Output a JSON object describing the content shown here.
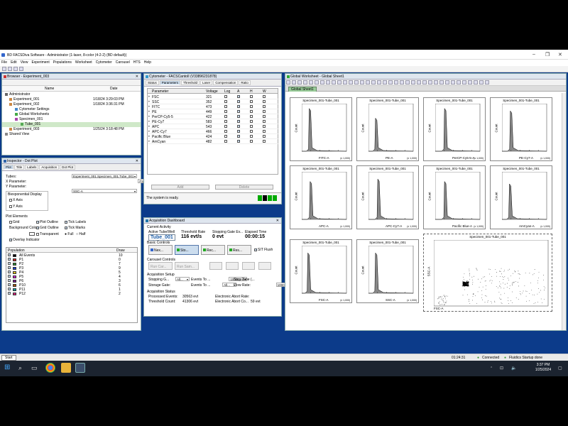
{
  "app": {
    "title": "BD FACSDiva Software - Administrator (1-laser, 8-color (4-2-2) (BD default))"
  },
  "menu": [
    "File",
    "Edit",
    "View",
    "Experiment",
    "Populations",
    "Worksheet",
    "Cytometer",
    "Carousel",
    "HTS",
    "Help"
  ],
  "browser": {
    "title": "Browser - Experiment_003",
    "col_name": "Name",
    "col_date": "Date",
    "items": [
      {
        "name": "Administrator",
        "date": ""
      },
      {
        "name": "Experiment_001",
        "date": "1/18/24 3:29:03 PM"
      },
      {
        "name": "Experiment_002",
        "date": "1/18/24 3:36:31 PM"
      },
      {
        "name": "Cytometer Settings",
        "date": ""
      },
      {
        "name": "Global Worksheets",
        "date": ""
      },
      {
        "name": "Specimen_001",
        "date": ""
      },
      {
        "name": "Tube_001",
        "date": ""
      },
      {
        "name": "Experiment_003",
        "date": "1/25/24 3:18:48 PM"
      },
      {
        "name": "Shared View",
        "date": ""
      }
    ]
  },
  "inspector": {
    "title": "Inspector - Dot Plot",
    "tabs": [
      "Plot",
      "Title",
      "Labels",
      "Acquisition",
      "Dot Plot"
    ],
    "tubes_label": "Tubes:",
    "tubes_value": "Experiment_001.Specimen_001.Tube_001",
    "xparam_label": "X Parameter:",
    "xparam_value": "FSC-A",
    "yparam_label": "Y Parameter:",
    "yparam_value": "SSC-A",
    "bi_label": "Biexponential Display",
    "xaxis": "X Axis",
    "yaxis": "Y Axis",
    "plot_elements": "Plot Elements",
    "grid": "Grid",
    "plot_outline": "Plot Outline",
    "tick_labels": "Tick Labels",
    "gridlines": "Grid Outline",
    "tick_marks": "Tick Marks",
    "bg_color": "Background Color:",
    "transparent": "Transparent",
    "full": "Full",
    "half": "Half",
    "overlay": "Overlay Indicator",
    "pop_header": "Population",
    "draw_header": "Draw",
    "populations": [
      {
        "name": "All Events",
        "draw": "10",
        "color": "#000000"
      },
      {
        "name": "P1",
        "draw": "0",
        "color": "#d62020"
      },
      {
        "name": "P2",
        "draw": "7",
        "color": "#2a8a2a"
      },
      {
        "name": "P3",
        "draw": "9",
        "color": "#1a3fd0"
      },
      {
        "name": "P4",
        "draw": "5",
        "color": "#e0c020"
      },
      {
        "name": "P5",
        "draw": "4",
        "color": "#d020d0"
      },
      {
        "name": "P6",
        "draw": "3",
        "color": "#7a1a8a"
      },
      {
        "name": "P10",
        "draw": "6",
        "color": "#aa5500"
      },
      {
        "name": "P11",
        "draw": "1",
        "color": "#00a0a0"
      },
      {
        "name": "P12",
        "draw": "2",
        "color": "#e02080"
      }
    ]
  },
  "cytometer": {
    "title": "Cytometer - FACSCantoII (V33896231878)",
    "tabs": [
      "Status",
      "Parameters",
      "Threshold",
      "Laser",
      "Compensation",
      "Ratio"
    ],
    "headers": [
      "Parameter",
      "Voltage",
      "Log",
      "A",
      "H",
      "W"
    ],
    "params": [
      {
        "name": "FSC",
        "voltage": "321"
      },
      {
        "name": "SSC",
        "voltage": "352"
      },
      {
        "name": "FITC",
        "voltage": "473"
      },
      {
        "name": "PE",
        "voltage": "449"
      },
      {
        "name": "PerCP-Cy5-5",
        "voltage": "422"
      },
      {
        "name": "PE-Cy7",
        "voltage": "583"
      },
      {
        "name": "APC",
        "voltage": "543"
      },
      {
        "name": "APC-Cy7",
        "voltage": "466"
      },
      {
        "name": "Pacific Blue",
        "voltage": "424"
      },
      {
        "name": "AmCyan",
        "voltage": "482"
      }
    ],
    "add": "Add",
    "delete": "Delete",
    "status": "The system is ready."
  },
  "acq": {
    "title": "Acquisition Dashboard",
    "current_activity": "Current Activity",
    "active_tube_label": "Active Tube/Well",
    "threshold_rate_label": "Threshold Rate",
    "stopping_gate_label": "Stopping Gate Ev...",
    "elapsed_label": "Elapsed Time",
    "active_tube": "Tube_001",
    "threshold_rate": "116 evt/s",
    "stopping_gate": "0 evt",
    "elapsed": "00:00:15",
    "basic_controls": "Basic Controls",
    "next": "Nex...",
    "stop": "Sto...",
    "record": "Rec...",
    "restart": "Res...",
    "sit_flush": "SIT Flush",
    "carousel_controls": "Carousel Controls",
    "run_car": "Run Car...",
    "run_sam": "Run Sam...",
    "acq_setup": "Acquisition Setup",
    "stopping_gate_field": "Stopping G...",
    "stopping_gate_value": "All...",
    "events_to_record_label": "Events To ...",
    "events_to_record": "10000 evt",
    "stop_time_label": "Stop Time (...",
    "stop_time": "0",
    "storage_gate_label": "Storage Gate:",
    "storage_gate_value": "All...",
    "events_to_display_label": "Events To ...",
    "events_to_display": "1000 evt",
    "flow_rate_label": "Flow Rate:",
    "flow_rate": "Low",
    "acq_status": "Acquisition Status",
    "processed_label": "Processed Events:",
    "processed": "30563 evt",
    "threshold_count_label": "Threshold Count:",
    "threshold_count": "41306 evt",
    "elec_abort_rate_label": "Electronic Abort Rate:",
    "elec_abort_rate": "",
    "elec_abort_count_label": "Electronic Abort Co...",
    "elec_abort_count": "59 evt"
  },
  "worksheet": {
    "title": "Global Worksheet - Global Sheet1",
    "tab": "Global Sheet1",
    "plot_title": "Specimen_001-Tube_001",
    "count_label": "Count",
    "histograms": [
      {
        "x_label": "FITC-A",
        "peak": 0.18,
        "height": 0.9
      },
      {
        "x_label": "PE-A",
        "peak": 0.17,
        "height": 0.7
      },
      {
        "x_label": "PerCP-Cy5-5-A",
        "peak": 0.22,
        "height": 0.9
      },
      {
        "x_label": "PE-Cy7-A",
        "peak": 0.2,
        "height": 0.85
      },
      {
        "x_label": "APC-A",
        "peak": 0.2,
        "height": 0.8
      },
      {
        "x_label": "APC-Cy7-A",
        "peak": 0.22,
        "height": 0.85
      },
      {
        "x_label": "Pacific Blue-A",
        "peak": 0.22,
        "height": 0.8
      },
      {
        "x_label": "AmCyan-A",
        "peak": 0.18,
        "height": 0.75
      },
      {
        "x_label": "FSC-A",
        "peak": 0.15,
        "height": 0.85
      },
      {
        "x_label": "SSC-A",
        "peak": 0.17,
        "height": 0.85
      }
    ],
    "dot_x": "FSC-A",
    "dot_y": "SSC-A",
    "tick_unit": "(x 1,000)"
  },
  "statusbar": {
    "time": "01:24:31",
    "connected": "Connected",
    "fluidics": "Fluidics Startup done"
  },
  "taskbar": {
    "start": "Start",
    "clock_time": "3:37 PM",
    "clock_date": "1/25/2024"
  }
}
